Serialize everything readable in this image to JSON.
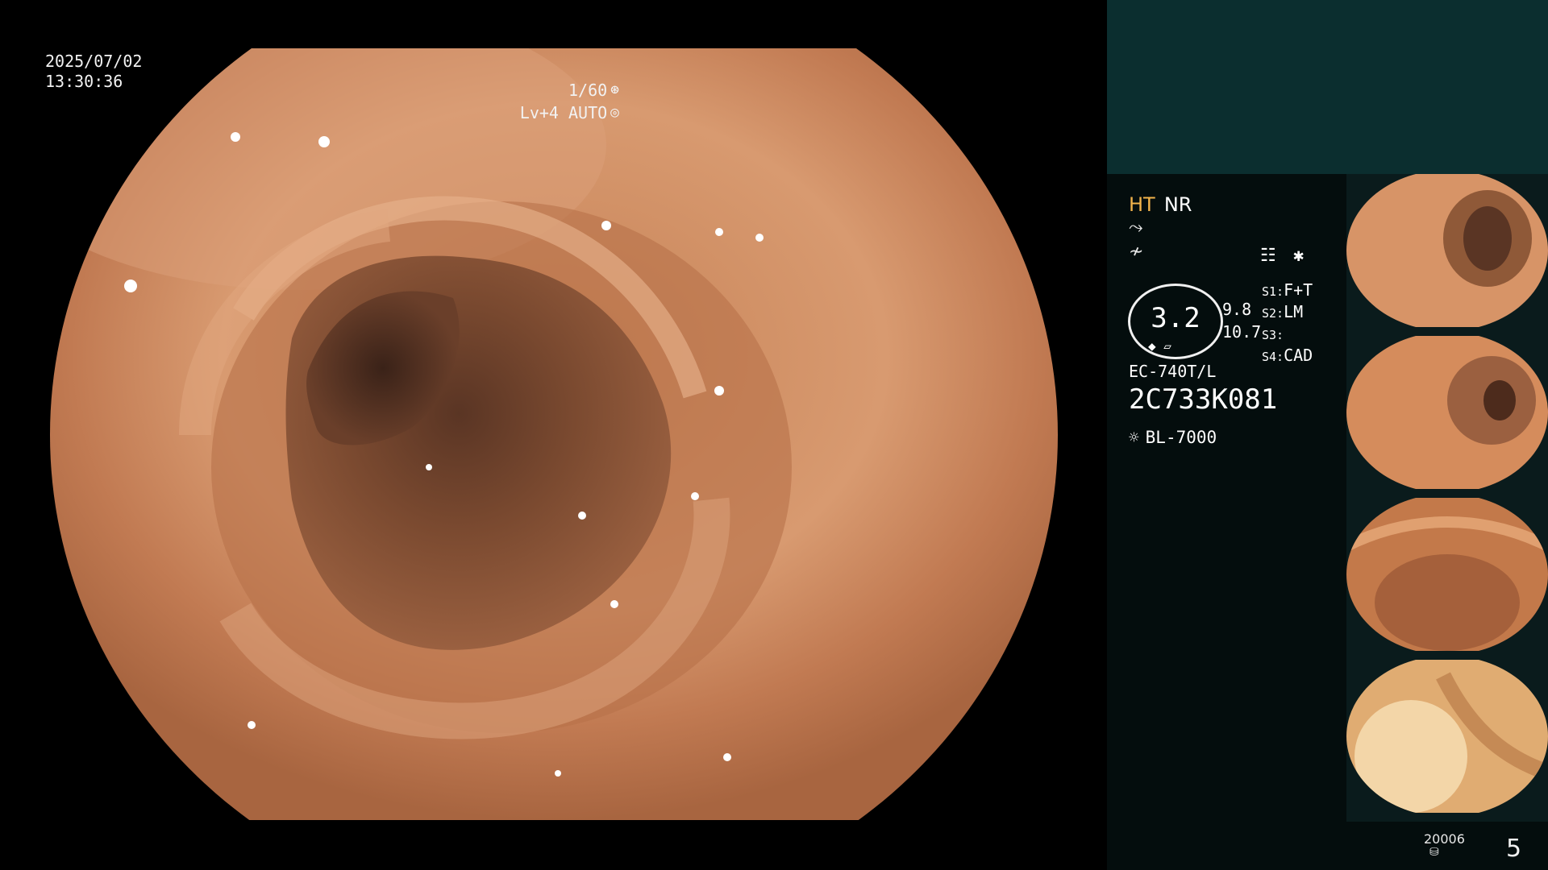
{
  "overlay": {
    "date": "2025/07/02",
    "time": "13:30:36",
    "shutter": "1/60",
    "shutter_icon": "aperture-icon",
    "level": "Lv+4 AUTO",
    "level_icon": "iris-icon"
  },
  "side_panel": {
    "mode_ht": "HT",
    "mode_nr": "NR",
    "icons": [
      "scope-tip-icon",
      "no-signal-icon",
      "settings-list-icon",
      "asterisk-icon"
    ],
    "gauge_value": "3.2",
    "gauge_value_2": "9.8",
    "gauge_value_3": "10.7",
    "switches": [
      {
        "key": "S1:",
        "val": "F+T"
      },
      {
        "key": "S2:",
        "val": "LM"
      },
      {
        "key": "S3:",
        "val": ""
      },
      {
        "key": "S4:",
        "val": "CAD"
      }
    ],
    "scope_model": "EC-740T/L",
    "scope_serial": "2C733K081",
    "light_source": "BL-7000",
    "light_icon": "sun-icon"
  },
  "footer": {
    "image_count": "20006",
    "page_number": "5",
    "disk_icon": "disk-icon"
  },
  "colors": {
    "accent_orange": "#f2b34b",
    "panel_top": "#0b2e2f",
    "panel_bg": "#040d0d"
  }
}
